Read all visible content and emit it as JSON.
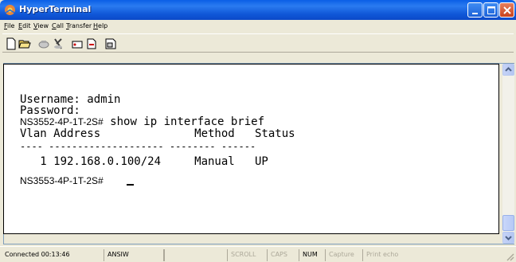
{
  "window": {
    "title": "HyperTerminal",
    "app_icon": "hyperterminal-icon",
    "controls": [
      "minimize-icon",
      "maximize-icon",
      "close-icon"
    ]
  },
  "menu": {
    "items": [
      {
        "label": "File"
      },
      {
        "label": "Edit"
      },
      {
        "label": "View"
      },
      {
        "label": "Call"
      },
      {
        "label": "Transfer"
      },
      {
        "label": "Help"
      }
    ]
  },
  "toolbar": {
    "buttons": [
      {
        "icon": "new-icon"
      },
      {
        "icon": "open-icon"
      },
      {
        "icon": "connect-icon"
      },
      {
        "icon": "disconnect-icon"
      },
      {
        "icon": "send-icon"
      },
      {
        "icon": "receive-icon"
      },
      {
        "icon": "properties-icon"
      }
    ]
  },
  "terminal": {
    "line1": "Username: admin",
    "line2": "Password:",
    "line3_prompt": "NS3552-4P-1T-2S#",
    "line3_cmd": " show ip interface brief",
    "header": "Vlan Address              Method   Status",
    "rule": "---- -------------------- -------- ------",
    "row1": "   1 192.168.0.100/24     Manual   UP",
    "prompt": "NS3553-4P-1T-2S#"
  },
  "status": {
    "connected": "Connected 00:13:46",
    "emulation": "ANSIW",
    "scroll": "SCROLL",
    "caps": "CAPS",
    "num": "NUM",
    "capture": "Capture",
    "print_echo": "Print echo"
  },
  "colors": {
    "titlebar": "#0a5fe6",
    "close_button": "#c8421c",
    "window_face": "#ece9d8",
    "terminal_bg": "#ffffff",
    "terminal_fg": "#000000"
  }
}
